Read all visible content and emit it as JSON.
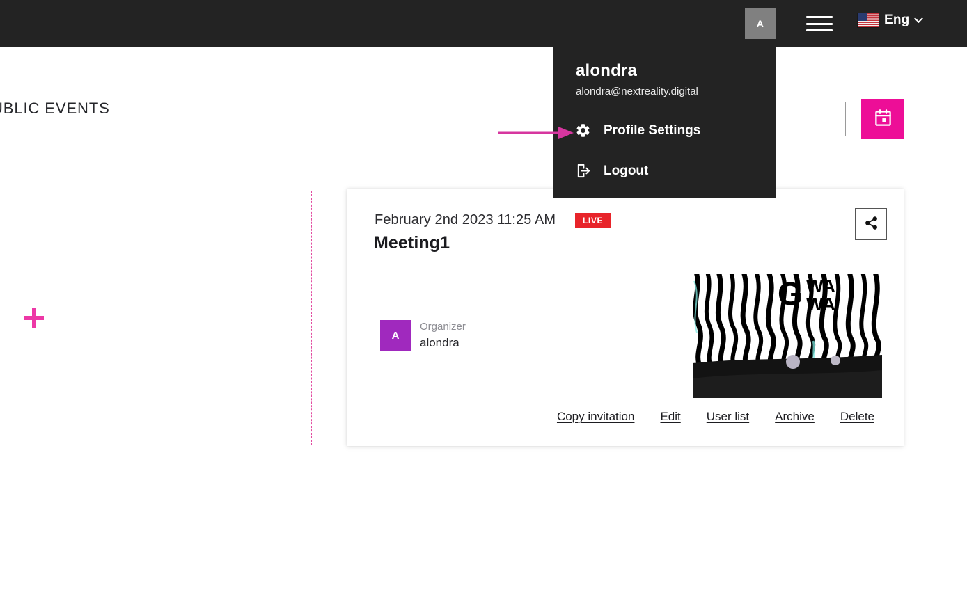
{
  "topbar": {
    "avatar_initial": "A",
    "avatar_bg": "#808080",
    "menu_icon": "hamburger-icon",
    "language_label": "Eng",
    "flag_icon": "us-flag-icon",
    "chevron_icon": "chevron-down-icon",
    "background": "#232323"
  },
  "profile_dropdown": {
    "username": "alondra",
    "email": "alondra@nextreality.digital",
    "items": [
      {
        "label": "Profile Settings",
        "icon": "gear-icon"
      },
      {
        "label": "Logout",
        "icon": "logout-icon"
      }
    ],
    "background": "#232323"
  },
  "annotation": {
    "type": "arrow",
    "color": "#D6369F",
    "points_to": "Profile Settings"
  },
  "page": {
    "heading": "UBLIC EVENTS"
  },
  "search": {
    "value": "",
    "placeholder": ""
  },
  "calendar_button": {
    "icon": "calendar-icon",
    "color": "#ED0E97"
  },
  "add_card": {
    "icon": "plus-icon",
    "border_color": "#e24aa0",
    "plus_color": "#ED38A6"
  },
  "meeting_card": {
    "date": "February 2nd 2023 11:25 AM",
    "status_badge": "LIVE",
    "status_color": "#E8242A",
    "title": "Meeting1",
    "share_icon": "share-icon",
    "organizer": {
      "avatar_initial": "A",
      "avatar_bg": "#A029BE",
      "role_label": "Organizer",
      "name": "alondra"
    },
    "thumbnail": {
      "alt": "meeting-preview-thumbnail"
    },
    "links": [
      {
        "label": "Copy invitation"
      },
      {
        "label": "Edit"
      },
      {
        "label": "User list"
      },
      {
        "label": "Archive"
      },
      {
        "label": "Delete"
      }
    ]
  }
}
